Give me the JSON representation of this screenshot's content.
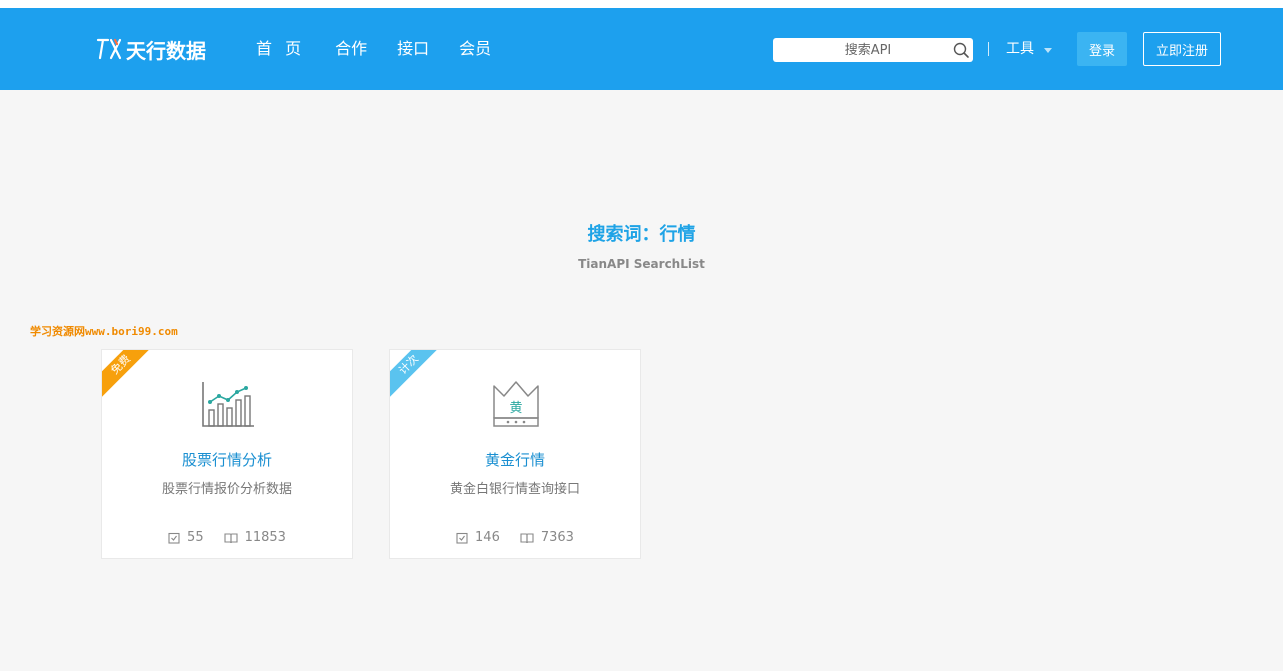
{
  "header": {
    "logo_text": "天行数据",
    "nav": [
      "首 页",
      "合作",
      "接口",
      "会员"
    ],
    "search_placeholder": "搜索API",
    "tools_label": "工具",
    "login_label": "登录",
    "register_label": "立即注册"
  },
  "search": {
    "title": "搜索词：行情",
    "subtitle": "TianAPI SearchList"
  },
  "watermark": "学习资源网www.bori99.com",
  "cards": [
    {
      "badge": "免费",
      "icon": "stock-chart-icon",
      "title": "股票行情分析",
      "desc": "股票行情报价分析数据",
      "checks": "55",
      "reads": "11853"
    },
    {
      "badge": "计次",
      "icon": "gold-crown-icon",
      "icon_text": "黄",
      "title": "黄金行情",
      "desc": "黄金白银行情查询接口",
      "checks": "146",
      "reads": "7363"
    }
  ],
  "colors": {
    "header": "#1da0ee",
    "accent": "#1ea3e6",
    "free_badge": "#f7a00c",
    "count_badge": "#5ac3ef"
  }
}
